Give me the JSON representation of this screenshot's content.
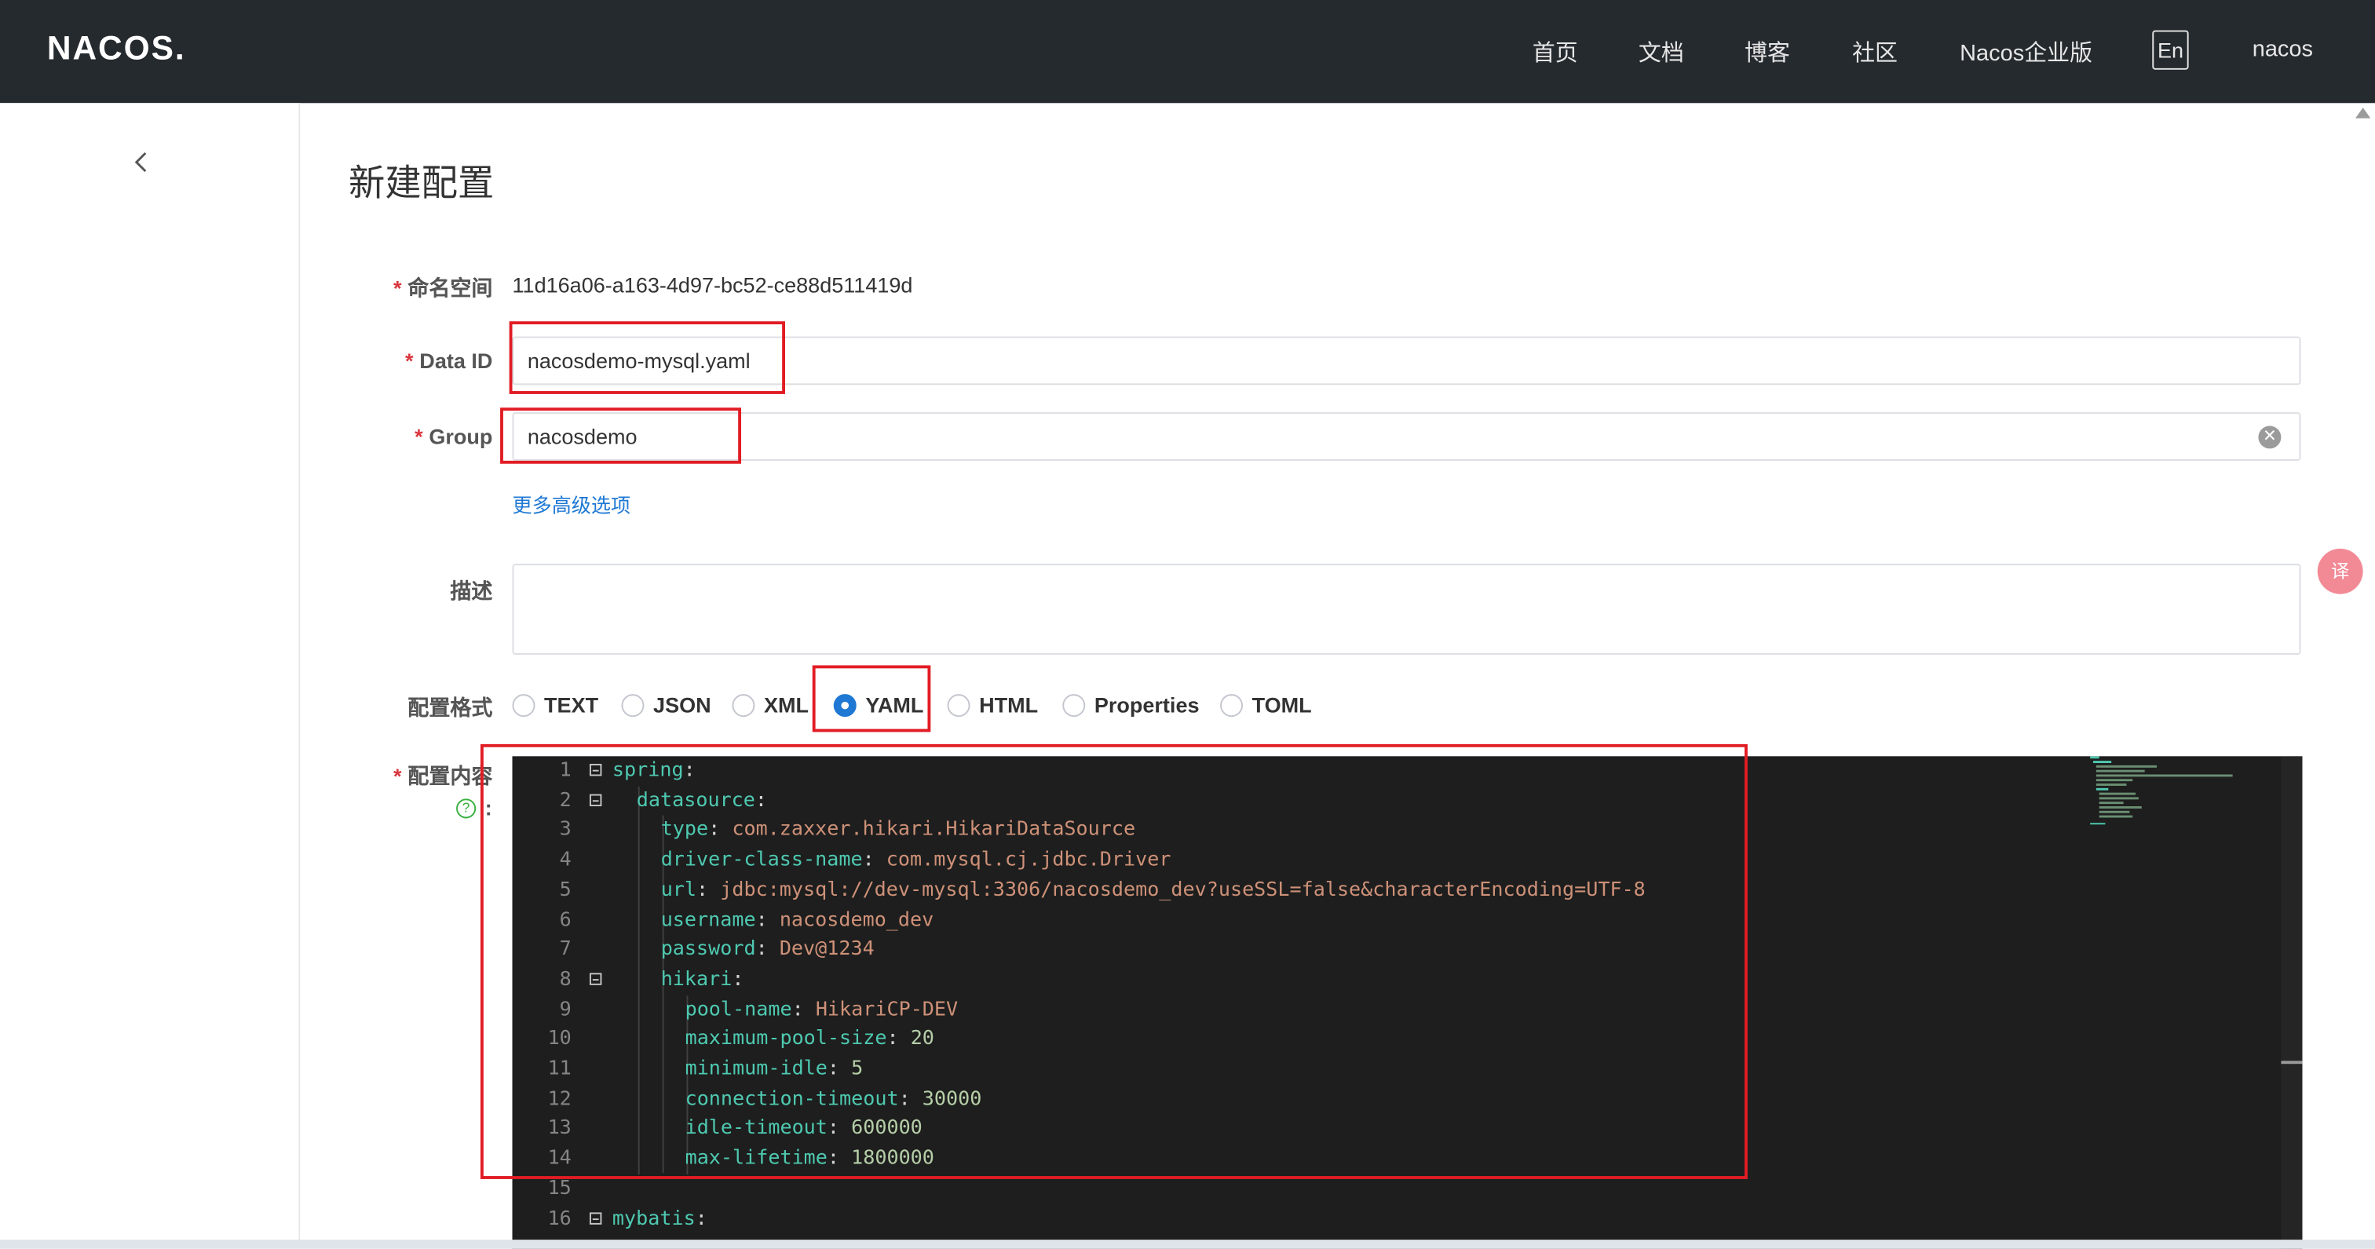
{
  "header": {
    "logo": "NACOS.",
    "nav": [
      "首页",
      "文档",
      "博客",
      "社区",
      "Nacos企业版"
    ],
    "lang": "En",
    "user": "nacos"
  },
  "page": {
    "title": "新建配置"
  },
  "form": {
    "namespace_label": "命名空间",
    "namespace_value": "11d16a06-a163-4d97-bc52-ce88d511419d",
    "dataid_label": "Data ID",
    "dataid_value": "nacosdemo-mysql.yaml",
    "group_label": "Group",
    "group_value": "nacosdemo",
    "advanced_link": "更多高级选项",
    "desc_label": "描述",
    "format_label": "配置格式",
    "formats": [
      "TEXT",
      "JSON",
      "XML",
      "YAML",
      "HTML",
      "Properties",
      "TOML"
    ],
    "format_selected": "YAML",
    "content_label": "配置内容",
    "content_colon": ":"
  },
  "editor": {
    "lines": [
      {
        "n": "1",
        "fold": true,
        "key": "spring",
        "sep": ":",
        "val": "",
        "vt": ""
      },
      {
        "n": "2",
        "fold": true,
        "key": "datasource",
        "sep": ":",
        "val": "",
        "vt": ""
      },
      {
        "n": "3",
        "fold": false,
        "key": "type",
        "sep": ": ",
        "val": "com.zaxxer.hikari.HikariDataSource",
        "vt": "s"
      },
      {
        "n": "4",
        "fold": false,
        "key": "driver-class-name",
        "sep": ": ",
        "val": "com.mysql.cj.jdbc.Driver",
        "vt": "s"
      },
      {
        "n": "5",
        "fold": false,
        "key": "url",
        "sep": ": ",
        "val": "jdbc:mysql://dev-mysql:3306/nacosdemo_dev?useSSL=false&characterEncoding=UTF-8",
        "vt": "s"
      },
      {
        "n": "6",
        "fold": false,
        "key": "username",
        "sep": ": ",
        "val": "nacosdemo_dev",
        "vt": "s"
      },
      {
        "n": "7",
        "fold": false,
        "key": "password",
        "sep": ": ",
        "val": "Dev@1234",
        "vt": "s"
      },
      {
        "n": "8",
        "fold": true,
        "key": "hikari",
        "sep": ":",
        "val": "",
        "vt": ""
      },
      {
        "n": "9",
        "fold": false,
        "key": "pool-name",
        "sep": ": ",
        "val": "HikariCP-DEV",
        "vt": "s"
      },
      {
        "n": "10",
        "fold": false,
        "key": "maximum-pool-size",
        "sep": ": ",
        "val": "20",
        "vt": "n"
      },
      {
        "n": "11",
        "fold": false,
        "key": "minimum-idle",
        "sep": ": ",
        "val": "5",
        "vt": "n"
      },
      {
        "n": "12",
        "fold": false,
        "key": "connection-timeout",
        "sep": ": ",
        "val": "30000",
        "vt": "n"
      },
      {
        "n": "13",
        "fold": false,
        "key": "idle-timeout",
        "sep": ": ",
        "val": "600000",
        "vt": "n"
      },
      {
        "n": "14",
        "fold": false,
        "key": "max-lifetime",
        "sep": ": ",
        "val": "1800000",
        "vt": "n"
      },
      {
        "n": "15",
        "fold": false,
        "key": "",
        "sep": "",
        "val": "",
        "vt": ""
      },
      {
        "n": "16",
        "fold": true,
        "key": "mybatis",
        "sep": ":",
        "val": "",
        "vt": ""
      }
    ]
  },
  "colors": {
    "topbar": "#252a2f",
    "accent": "#1e78d4",
    "annotation": "#e11c24",
    "editor_bg": "#1e1e1e"
  },
  "icons": {
    "back": "chevron-left-icon",
    "clear": "clear-circle-icon",
    "help": "help-circle-icon",
    "translate": "translate-icon"
  }
}
